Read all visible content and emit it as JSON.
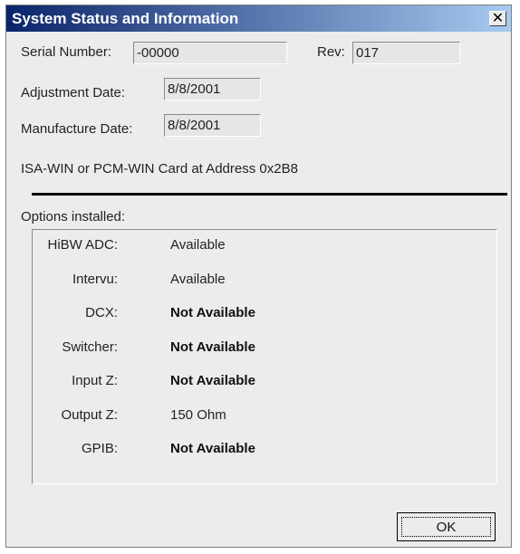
{
  "window": {
    "title": "System Status and Information",
    "close_glyph": "✕"
  },
  "serial": {
    "label": "Serial Number:",
    "value": "-00000"
  },
  "rev": {
    "label": "Rev:",
    "value": "017"
  },
  "adjustment": {
    "label": "Adjustment Date:",
    "value": "8/8/2001"
  },
  "manufacture": {
    "label": "Manufacture Date:",
    "value": "8/8/2001"
  },
  "card_info": "ISA-WIN or PCM-WIN Card at Address 0x2B8",
  "options": {
    "heading": "Options installed:",
    "items": [
      {
        "label": "HiBW ADC:",
        "value": "Available"
      },
      {
        "label": "Intervu:",
        "value": "Available"
      },
      {
        "label": "DCX:",
        "value": "Not Available"
      },
      {
        "label": "Switcher:",
        "value": "Not Available"
      },
      {
        "label": "Input Z:",
        "value": "Not Available"
      },
      {
        "label": "Output Z:",
        "value": "150 Ohm"
      },
      {
        "label": "GPIB:",
        "value": "Not Available"
      }
    ]
  },
  "buttons": {
    "ok_label": "OK"
  }
}
